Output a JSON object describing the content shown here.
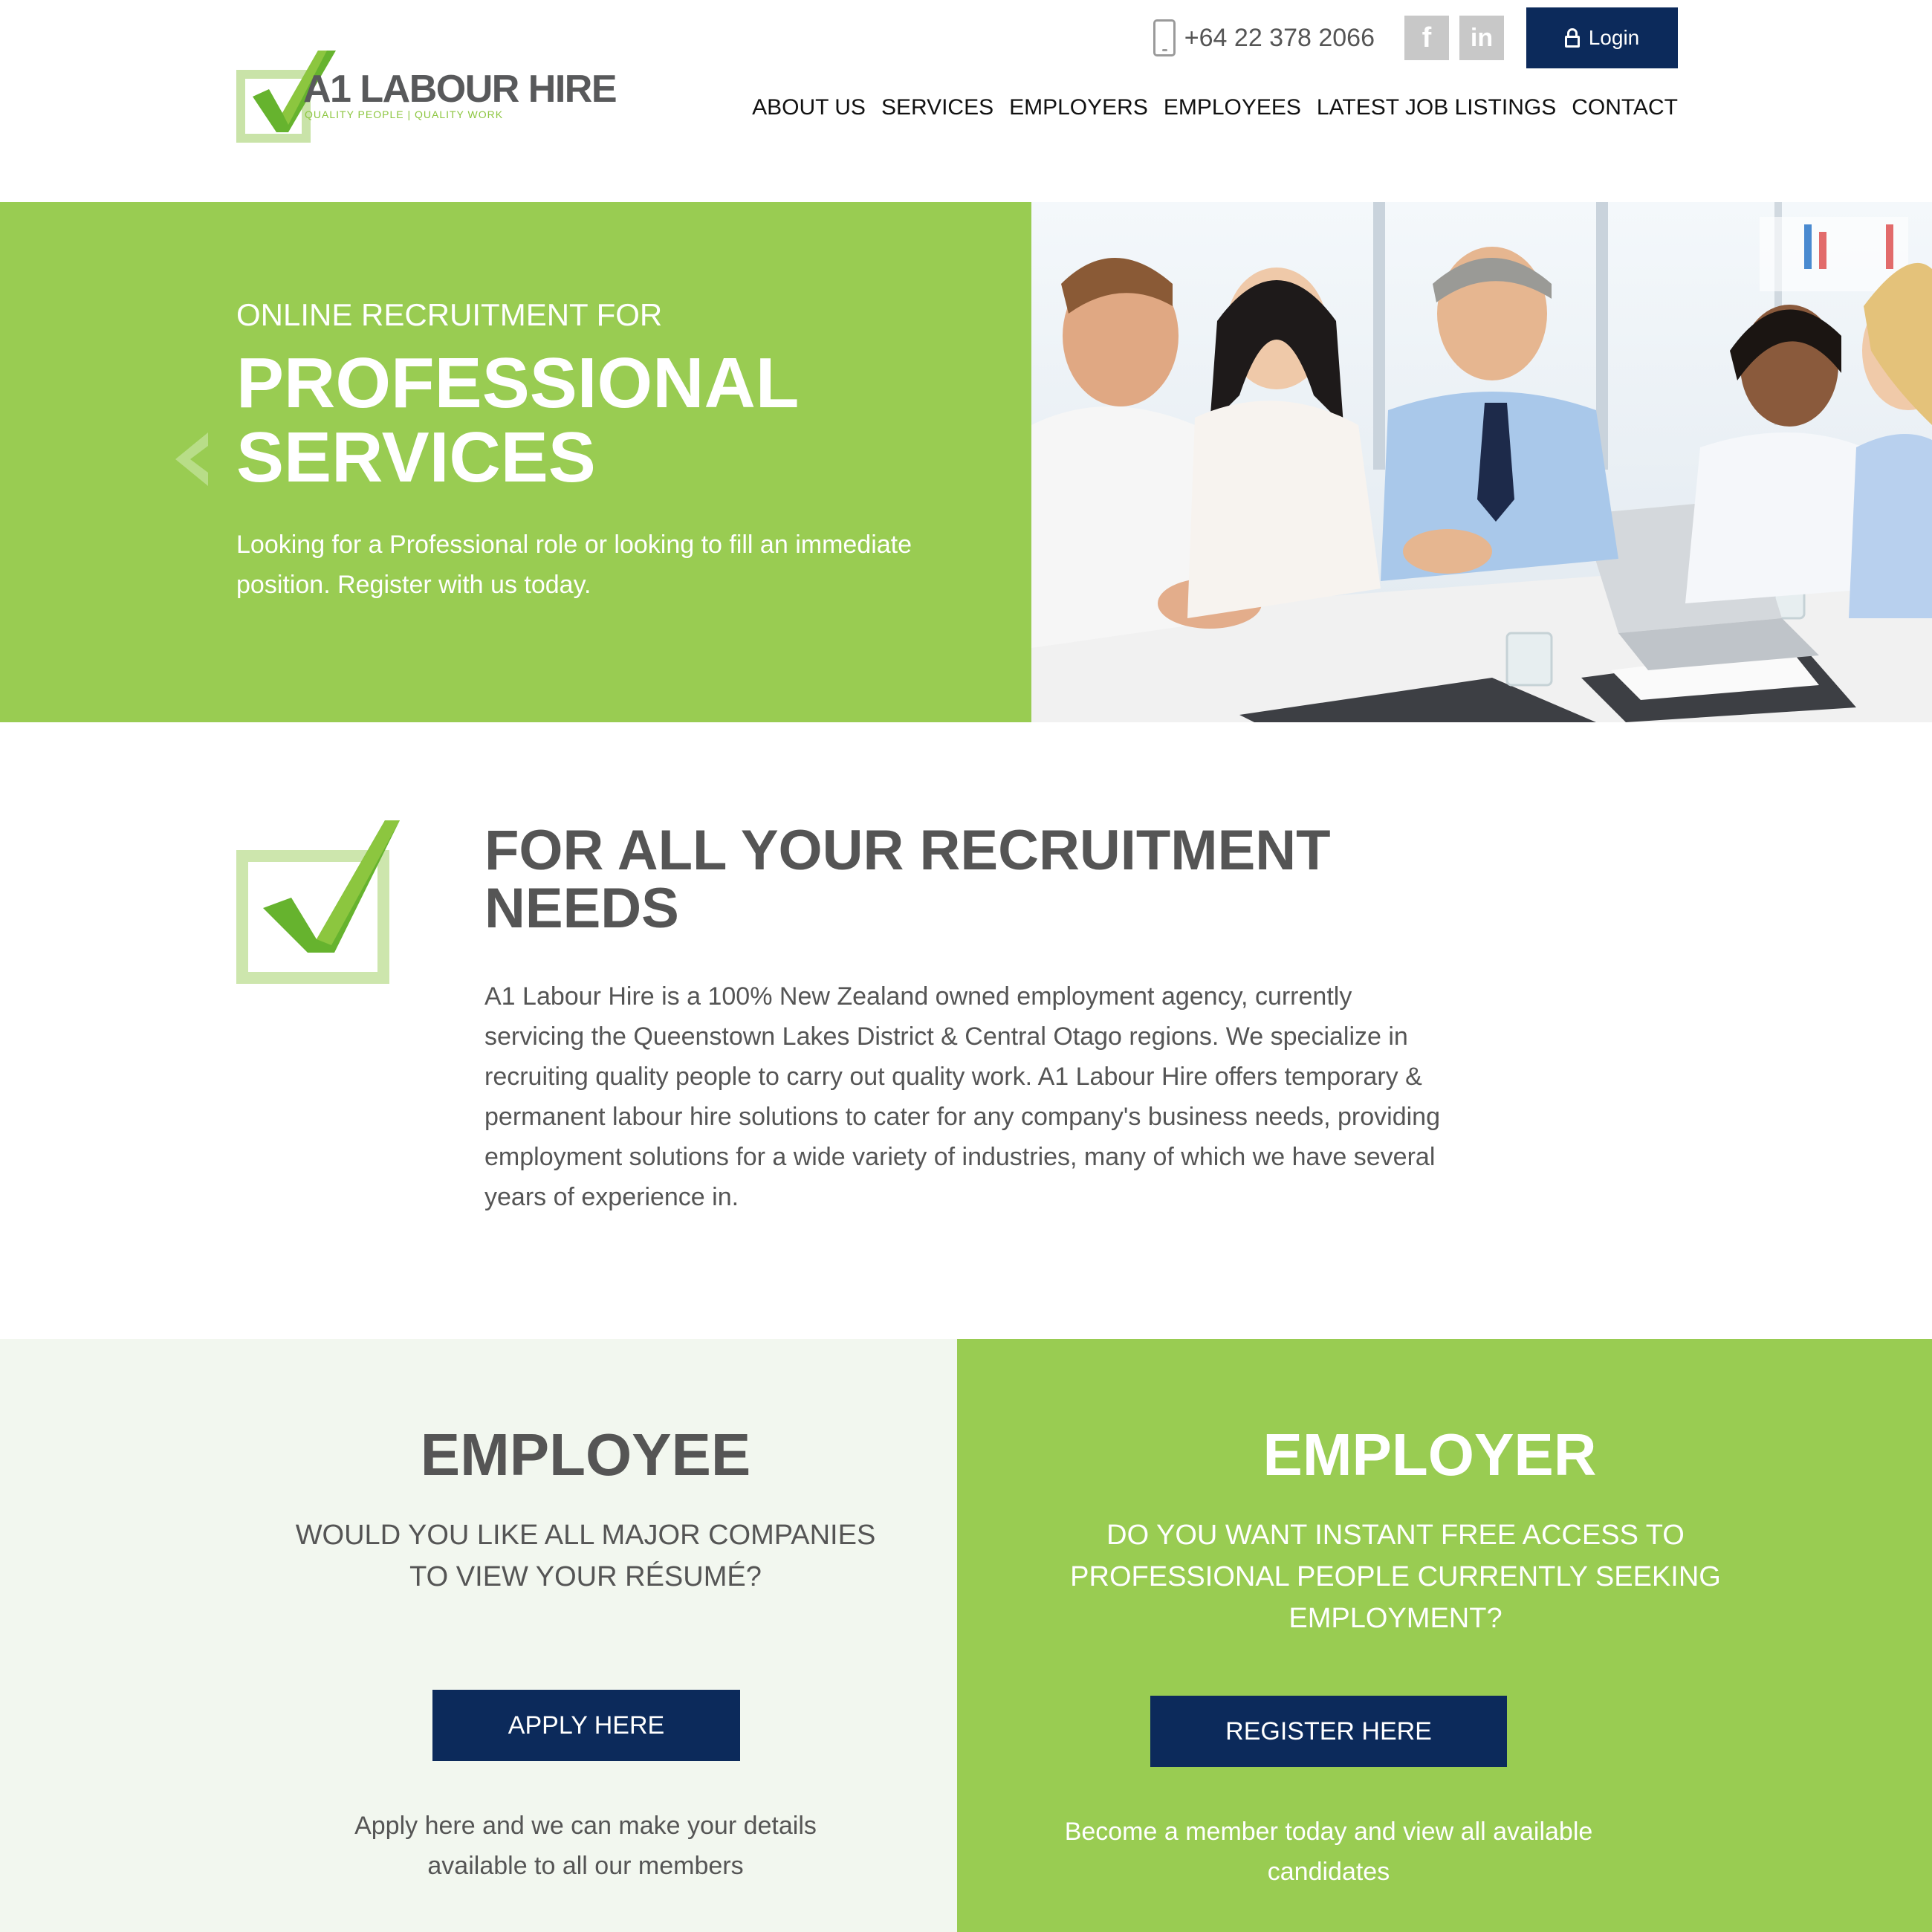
{
  "header": {
    "logo": {
      "title": "A1 LABOUR HIRE",
      "tagline": "QUALITY PEOPLE | QUALITY WORK"
    },
    "phone": "+64 22 378 2066",
    "social": [
      {
        "name": "facebook",
        "glyph": "f"
      },
      {
        "name": "linkedin",
        "glyph": "in"
      }
    ],
    "login_label": "Login",
    "nav": [
      "ABOUT US",
      "SERVICES",
      "EMPLOYERS",
      "EMPLOYEES",
      "LATEST JOB LISTINGS",
      "CONTACT"
    ]
  },
  "hero": {
    "subtitle": "ONLINE RECRUITMENT FOR",
    "title_line1": "PROFESSIONAL",
    "title_line2": "SERVICES",
    "description": "Looking for a Professional role or looking to fill an immediate position. Register with us today."
  },
  "about": {
    "title": "FOR ALL YOUR RECRUITMENT NEEDS",
    "text": "A1 Labour Hire is a 100% New Zealand owned employment agency, currently servicing the Queenstown Lakes District & Central Otago regions. We specialize in recruiting quality people to carry out quality work. A1 Labour Hire offers temporary & permanent labour hire solutions to cater for any company's business needs, providing employment solutions for a wide variety of industries, many of which we have several years of experience in."
  },
  "employee": {
    "title": "EMPLOYEE",
    "question": "WOULD YOU LIKE ALL MAJOR COMPANIES TO VIEW YOUR RÉSUMÉ?",
    "button": "APPLY HERE",
    "description": "Apply here and we can make your details available to all our members"
  },
  "employer": {
    "title": "EMPLOYER",
    "question": "DO YOU WANT INSTANT FREE ACCESS TO PROFESSIONAL PEOPLE CURRENTLY SEEKING EMPLOYMENT?",
    "button": "REGISTER HERE",
    "description": "Become a member today and view all available candidates"
  },
  "colors": {
    "brand_green": "#99cc52",
    "navy": "#0c2a5b",
    "light_green_bg": "#f2f7ef",
    "text_gray": "#555555"
  }
}
